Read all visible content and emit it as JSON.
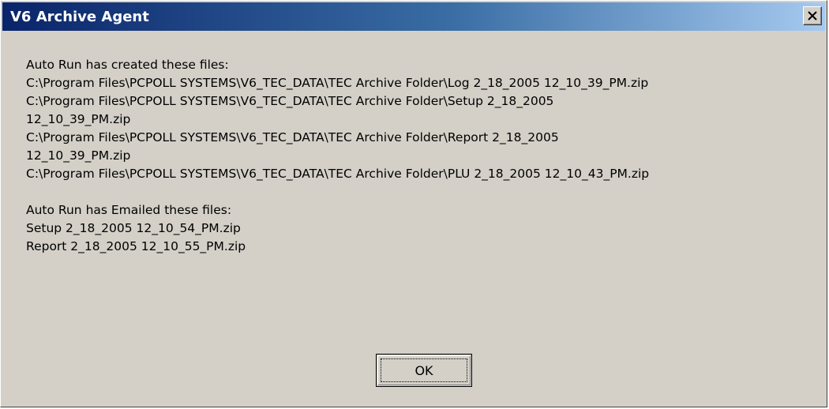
{
  "window": {
    "title": "V6 Archive Agent"
  },
  "message": {
    "created_heading": "Auto Run has created these files:",
    "created_files": [
      "C:\\Program Files\\PCPOLL SYSTEMS\\V6_TEC_DATA\\TEC Archive Folder\\Log 2_18_2005 12_10_39_PM.zip",
      "C:\\Program Files\\PCPOLL SYSTEMS\\V6_TEC_DATA\\TEC Archive Folder\\Setup 2_18_2005",
      "12_10_39_PM.zip",
      "C:\\Program Files\\PCPOLL SYSTEMS\\V6_TEC_DATA\\TEC Archive Folder\\Report 2_18_2005",
      "12_10_39_PM.zip",
      "C:\\Program Files\\PCPOLL SYSTEMS\\V6_TEC_DATA\\TEC Archive Folder\\PLU 2_18_2005 12_10_43_PM.zip"
    ],
    "emailed_heading": "Auto Run has Emailed these files:",
    "emailed_files": [
      "Setup 2_18_2005 12_10_54_PM.zip",
      "Report 2_18_2005 12_10_55_PM.zip"
    ]
  },
  "buttons": {
    "ok_label": "OK"
  },
  "icons": {
    "close": "close-icon"
  }
}
